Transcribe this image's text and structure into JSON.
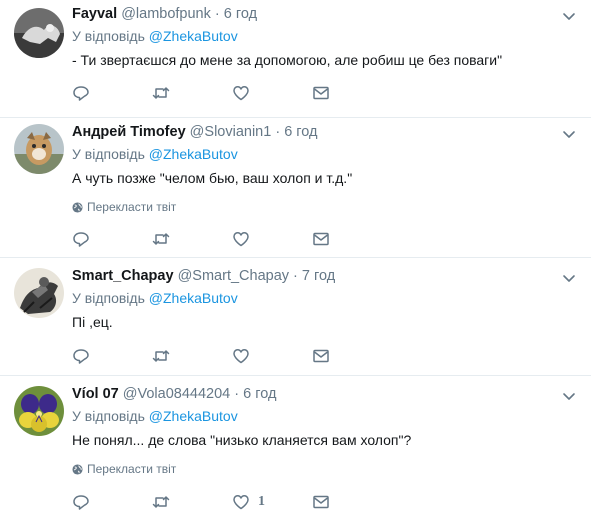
{
  "tweets": [
    {
      "fullname": "Fayval",
      "username": "@lambofpunk",
      "time": "6 год",
      "reply_prefix": "У відповідь",
      "reply_to": "@ZhekaButov",
      "text": "- Ти звертаєшся до мене за допомогою, але робиш це без поваги\"",
      "like_count": ""
    },
    {
      "fullname": "Андрей Timofey",
      "username": "@Slovianin1",
      "time": "6 год",
      "reply_prefix": "У відповідь",
      "reply_to": "@ZhekaButov",
      "text": "А чуть позже \"челом бью, ваш холоп и т.д.\"",
      "translate": "Перекласти твіт",
      "like_count": ""
    },
    {
      "fullname": "Smart_Chapay",
      "username": "@Smart_Chapay",
      "time": "7 год",
      "reply_prefix": "У відповідь",
      "reply_to": "@ZhekaButov",
      "text": "Пі   ,ец.",
      "like_count": ""
    },
    {
      "fullname": "Víol 07",
      "username": "@Vola08444204",
      "time": "6 год",
      "reply_prefix": "У відповідь",
      "reply_to": "@ZhekaButov",
      "text": "Не понял... де слова \"низько кланяется вам холоп\"?",
      "translate": "Перекласти твіт",
      "like_count": "1"
    }
  ],
  "separator": "·",
  "colors": {
    "link": "#1b95e0",
    "secondary": "#657786",
    "text": "#14171a",
    "border": "#e6ecf0"
  },
  "icons": [
    "reply-icon",
    "retweet-icon",
    "like-icon",
    "direct-message-icon",
    "caret-down-icon",
    "globe-icon"
  ]
}
